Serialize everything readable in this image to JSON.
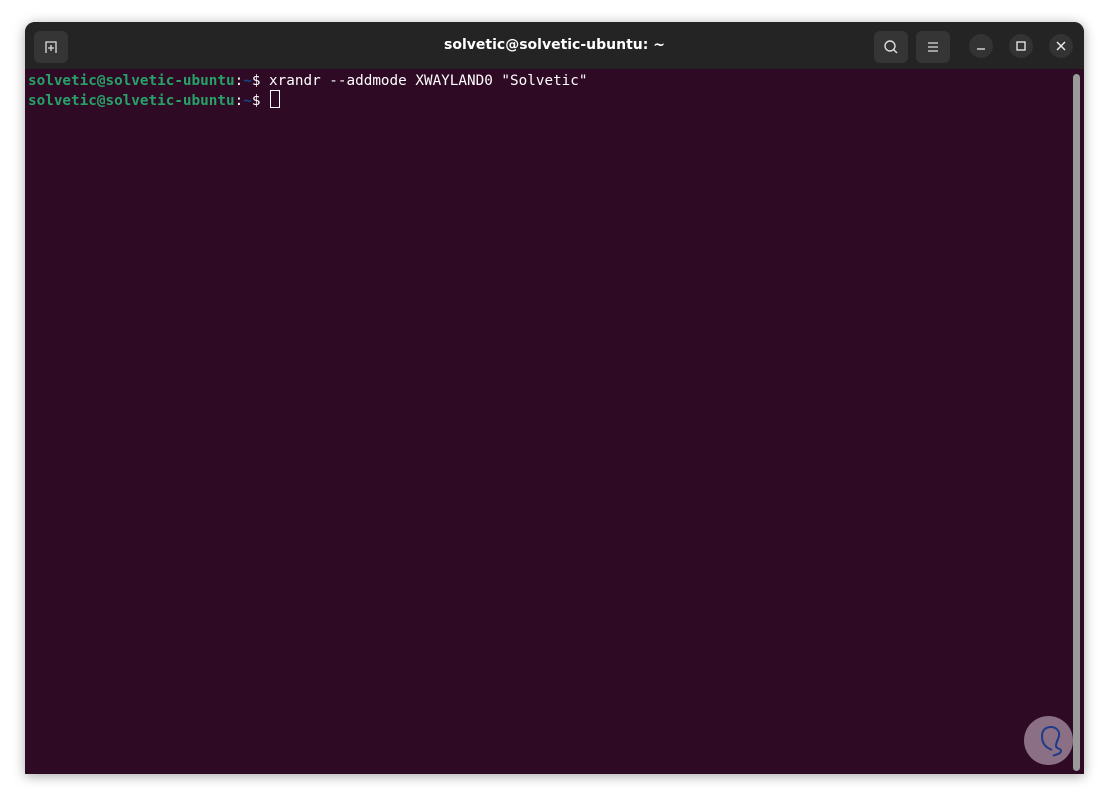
{
  "window": {
    "title": "solvetic@solvetic-ubuntu: ~"
  },
  "terminal": {
    "lines": [
      {
        "user": "solvetic@solvetic-ubuntu",
        "sep": ":",
        "path": "~",
        "prompt": "$ ",
        "command": "xrandr --addmode XWAYLAND0 \"Solvetic\""
      },
      {
        "user": "solvetic@solvetic-ubuntu",
        "sep": ":",
        "path": "~",
        "prompt": "$ ",
        "command": ""
      }
    ]
  },
  "colors": {
    "background": "#2f0a24",
    "user": "#26a269",
    "path": "#12488b"
  }
}
